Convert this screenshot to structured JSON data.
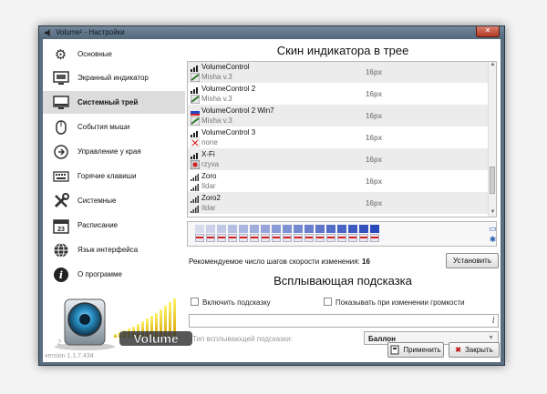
{
  "window": {
    "title": "Volume² - Настройки",
    "close_label": "✕"
  },
  "sidebar": {
    "items": [
      {
        "label": "Основные",
        "icon": "gear-icon"
      },
      {
        "label": "Экранный индикатор",
        "icon": "screen-indicator-icon"
      },
      {
        "label": "Системный трей",
        "icon": "system-tray-icon",
        "active": true
      },
      {
        "label": "События мыши",
        "icon": "mouse-icon"
      },
      {
        "label": "Управление у края",
        "icon": "screen-edge-icon"
      },
      {
        "label": "Горячие клавиши",
        "icon": "keyboard-icon"
      },
      {
        "label": "Системные",
        "icon": "tools-icon"
      },
      {
        "label": "Расписание",
        "icon": "calendar-icon",
        "badge": "23"
      },
      {
        "label": "Язык интерфейса",
        "icon": "globe-icon"
      },
      {
        "label": "О программе",
        "icon": "info-icon"
      }
    ],
    "logo_text": "Volume",
    "logo_sup": "2",
    "version": "version 1.1.7.434"
  },
  "tray_section": {
    "title": "Скин индикатора в трее",
    "skins": [
      {
        "name": "VolumeControl",
        "author": "Misha v.3",
        "size": "16px"
      },
      {
        "name": "VolumeControl 2",
        "author": "Misha v.3",
        "size": "16px"
      },
      {
        "name": "VolumeControl 2 Win7",
        "author": "Misha v.3",
        "size": "16px"
      },
      {
        "name": "VolumeControl 3",
        "author": "none",
        "size": "16px"
      },
      {
        "name": "X-Fi",
        "author": "rzyxa",
        "size": "16px"
      },
      {
        "name": "Zoro",
        "author": "Ildar",
        "size": "16px"
      },
      {
        "name": "Zoro2",
        "author": "Ildar",
        "size": "16px"
      }
    ],
    "recommended_label": "Рекомендуемое число шагов скорости изменения:",
    "recommended_value": "16",
    "install_button": "Установить"
  },
  "tooltip_section": {
    "title": "Всплывающая подсказка",
    "enable_label": "Включить подсказку",
    "show_on_change_label": "Показывать при изменении громкости",
    "text_field_value": "",
    "type_label": "Тип всплывающей подсказки:",
    "type_value": "Баллон"
  },
  "footer": {
    "apply_button": "Применить",
    "close_button": "Закрыть"
  }
}
